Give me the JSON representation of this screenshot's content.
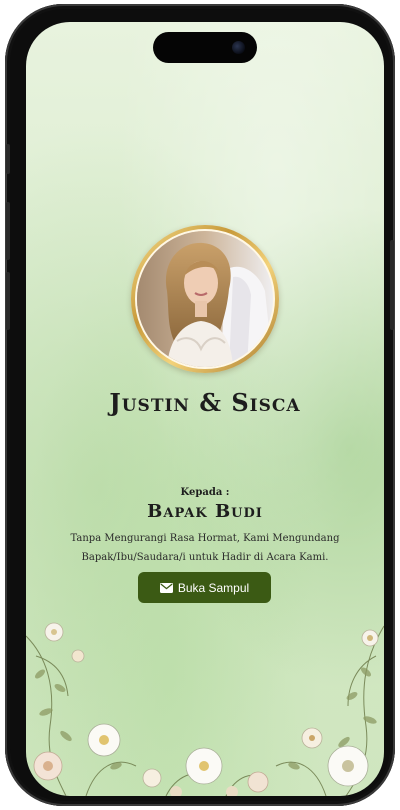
{
  "invitation": {
    "couple_name": "Justin & Sisca",
    "to_label": "Kepada :",
    "guest_name": "Bapak Budi",
    "message_line1": "Tanpa Mengurangi Rasa Hormat, Kami Mengundang",
    "message_line2": "Bapak/Ibu/Saudara/i untuk Hadir di Acara Kami.",
    "open_button_label": "Buka Sampul",
    "open_button_icon": "envelope-icon"
  },
  "colors": {
    "background": "#dcedd0",
    "button": "#3b5a14",
    "frame_gold": "#c89a3a",
    "text": "#1d1d1d"
  }
}
